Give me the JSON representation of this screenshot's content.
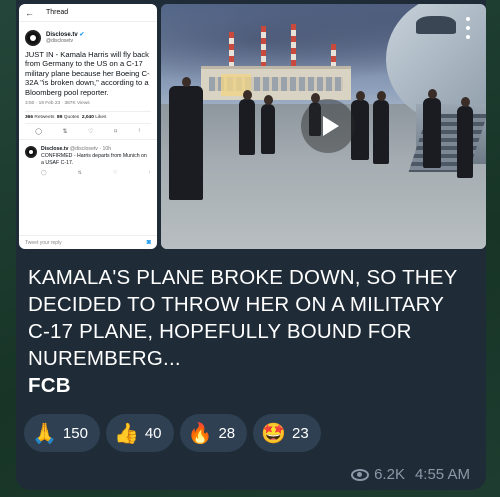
{
  "tweet": {
    "header_title": "Thread",
    "author_name": "Disclose.tv",
    "author_handle": "@disclosetv",
    "body": "JUST IN - Kamala Harris will fly back from Germany to the US on a C-17 military plane because her Boeing C-32A \"is broken down,\" according to a Bloomberg pool reporter.",
    "meta": "3:50 · 19 Feb 23 · 387K Views",
    "stats": {
      "retweets": "366",
      "retweets_label": "Retweets",
      "quotes": "89",
      "quotes_label": "Quotes",
      "likes": "2,040",
      "likes_label": "Likes"
    },
    "reply": {
      "name": "Disclose.tv",
      "handle": "@disclosetv · 10h",
      "text": "CONFIRMED - Harris departs from Munich on a USAF C-17."
    },
    "footer_placeholder": "Tweet your reply"
  },
  "caption": {
    "text": "KAMALA'S PLANE BROKE DOWN, SO THEY DECIDED TO THROW HER ON A MILITARY C-17 PLANE, HOPEFULLY BOUND FOR NUREMBERG...",
    "signature": "FCB"
  },
  "reactions": [
    {
      "emoji": "🙏",
      "count": "150"
    },
    {
      "emoji": "👍",
      "count": "40"
    },
    {
      "emoji": "🔥",
      "count": "28"
    },
    {
      "emoji": "🤩",
      "count": "23"
    }
  ],
  "meta": {
    "views": "6.2K",
    "time": "4:55 AM"
  },
  "icons": {
    "play": "play-icon",
    "menu": "more-vertical-icon",
    "views": "eye-icon"
  },
  "colors": {
    "bubble": "#1f2c38",
    "reaction_bg": "#2e4052",
    "meta_text": "#8a98a8",
    "background": "#1a3a2a"
  }
}
